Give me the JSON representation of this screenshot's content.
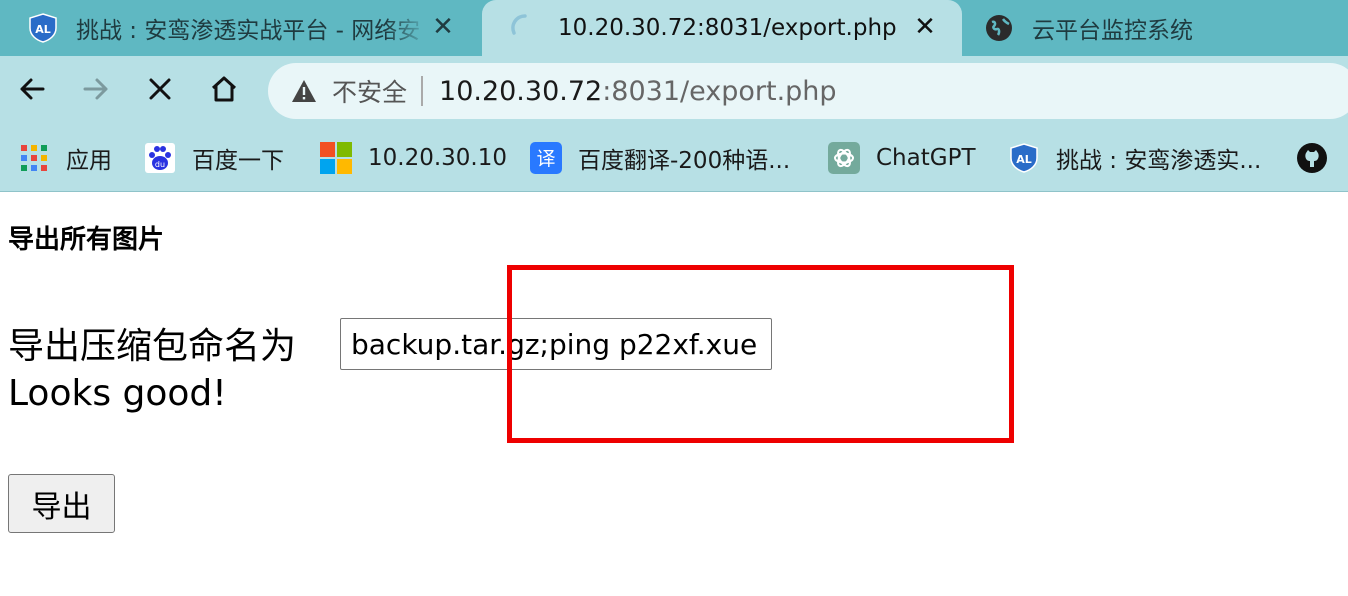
{
  "tabs": [
    {
      "title": "挑战 : 安鸾渗透实战平台 - 网络安",
      "icon": "anluan-logo-icon",
      "active": false
    },
    {
      "title": "10.20.30.72:8031/export.php",
      "icon": "loading-spinner-icon",
      "active": true
    },
    {
      "title": "云平台监控系统",
      "icon": "globe-icon",
      "active": false
    }
  ],
  "toolbar": {
    "security_label": "不安全",
    "url_host": "10.20.30.72",
    "url_path": ":8031/export.php"
  },
  "bookmarks": [
    {
      "label": "应用",
      "icon": "apps-grid-icon"
    },
    {
      "label": "百度一下",
      "icon": "baidu-paw-icon"
    },
    {
      "label": "10.20.30.10",
      "icon": "windows-logo-icon"
    },
    {
      "label": "百度翻译-200种语...",
      "icon": "translate-icon"
    },
    {
      "label": "ChatGPT",
      "icon": "chatgpt-icon"
    },
    {
      "label": "挑战 : 安鸾渗透实...",
      "icon": "anluan-logo-icon"
    }
  ],
  "page": {
    "heading": "导出所有图片",
    "input_label": "导出压缩包命名为",
    "input_value": "backup.tar.gz;ping p22xf.xue",
    "status_text": "Looks good!",
    "button_label": "导出"
  },
  "colors": {
    "tabstrip": "#5fb8c2",
    "toolbar": "#b7e0e5",
    "omnibox": "#e9f6f8",
    "highlight": "#ee0000"
  }
}
